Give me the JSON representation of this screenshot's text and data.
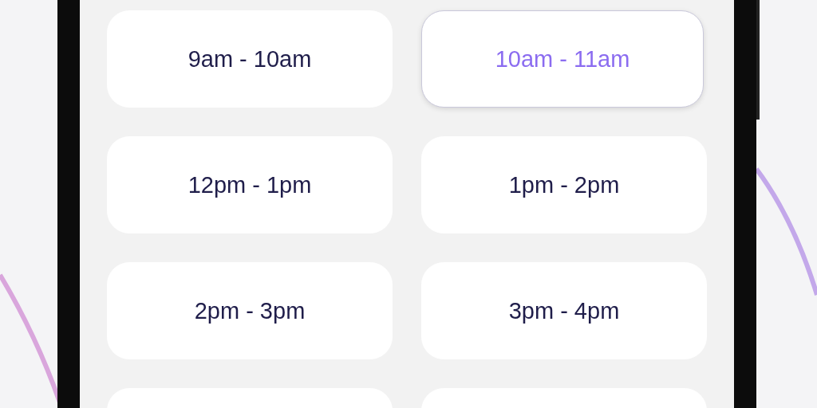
{
  "time_slots": [
    {
      "label": "9am - 10am",
      "selected": false
    },
    {
      "label": "10am - 11am",
      "selected": true
    },
    {
      "label": "12pm - 1pm",
      "selected": false
    },
    {
      "label": "1pm - 2pm",
      "selected": false
    },
    {
      "label": "2pm - 3pm",
      "selected": false
    },
    {
      "label": "3pm - 4pm",
      "selected": false
    },
    {
      "selected": false
    },
    {
      "selected": false
    }
  ]
}
